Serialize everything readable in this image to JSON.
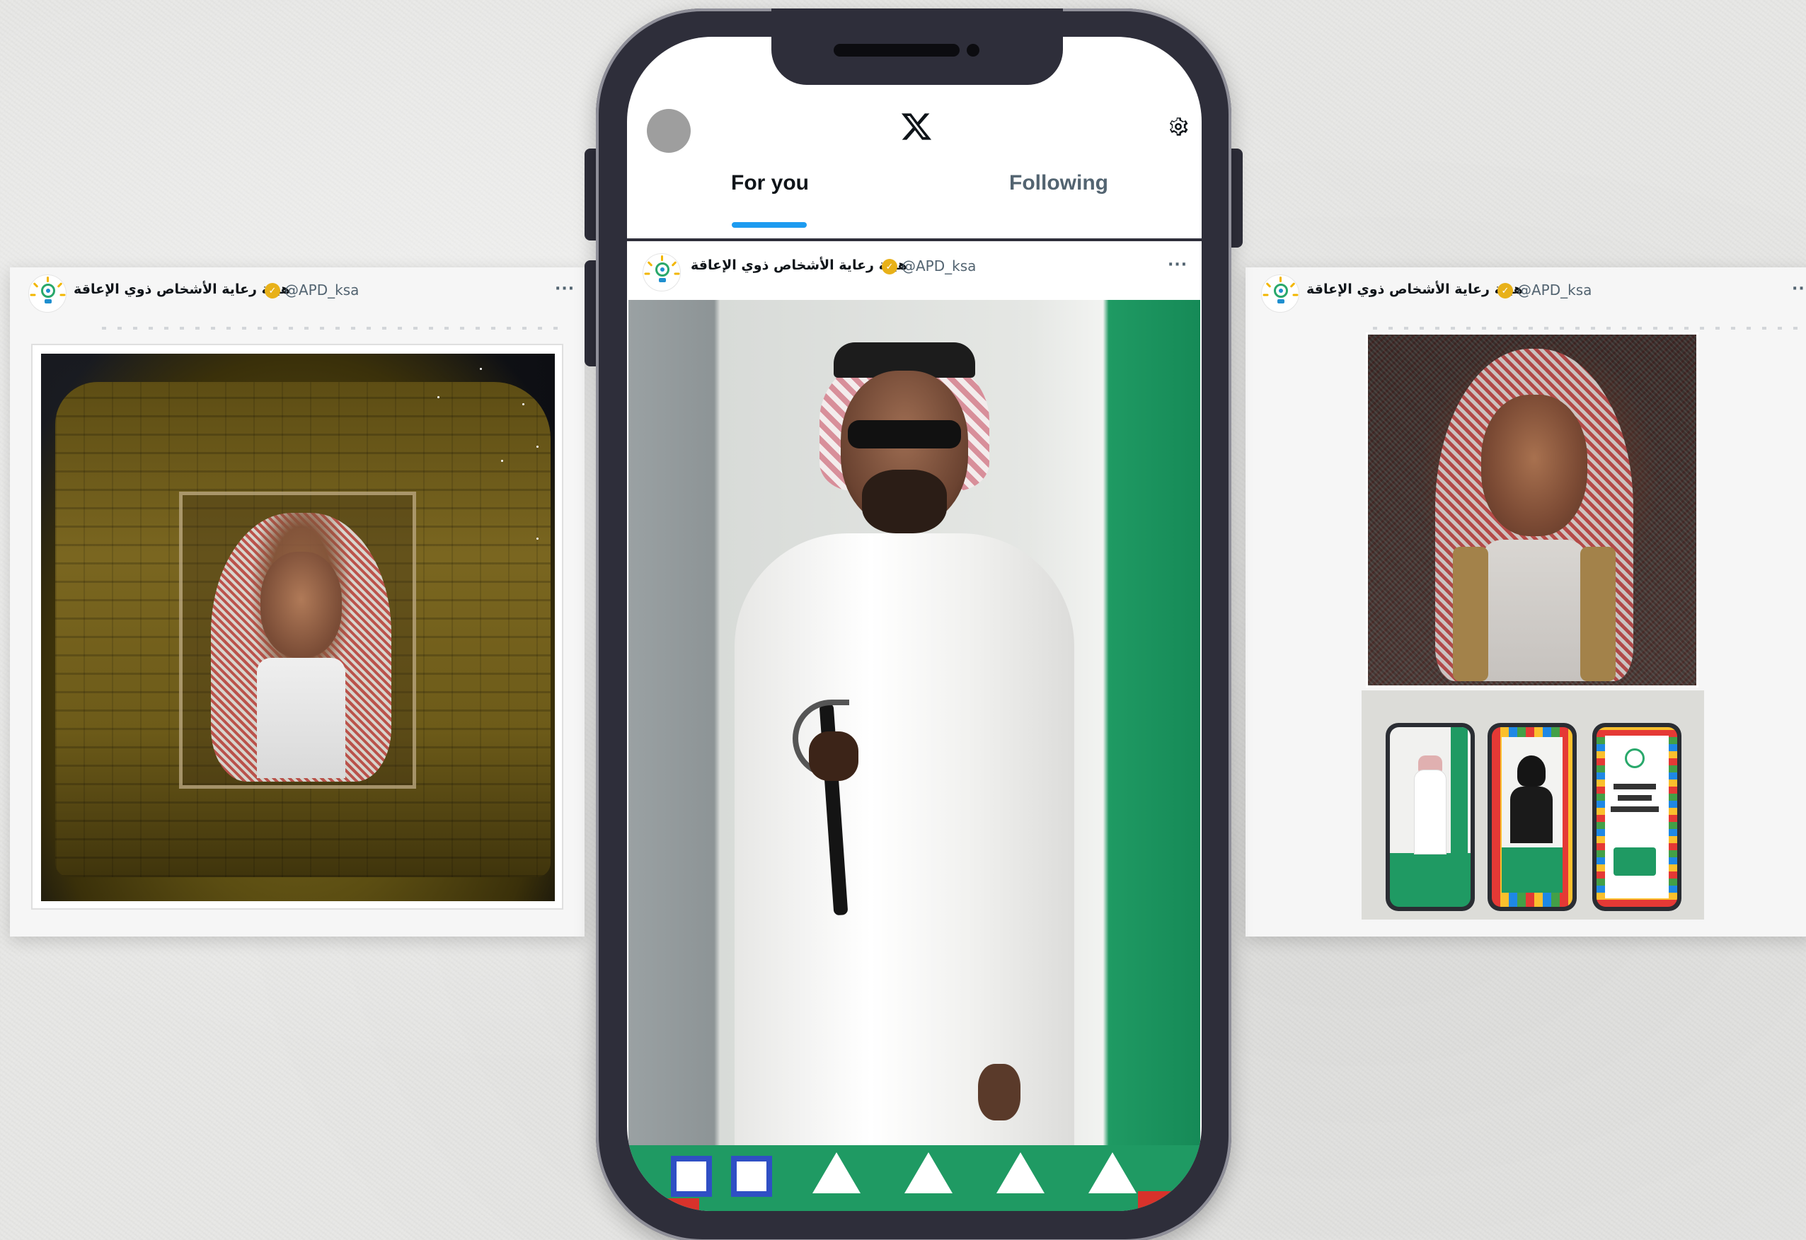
{
  "left_card": {
    "account_name": "هيئة رعاية الأشخاص ذوي الإعاقة",
    "handle": "@APD_ksa",
    "more": "···"
  },
  "right_card": {
    "account_name": "هيئة رعاية الأشخاص ذوي الإعاقة",
    "handle": "@APD_ksa",
    "more": "···"
  },
  "phone_app": {
    "logo": "x-logo",
    "tabs": [
      {
        "label": "For you",
        "active": true
      },
      {
        "label": "Following",
        "active": false
      }
    ],
    "post": {
      "account_name": "هيئة رعاية الأشخاص ذوي الإعاقة",
      "handle": "@APD_ksa",
      "more": "···"
    }
  },
  "colors": {
    "accent": "#1d9bf0",
    "verified": "#e8b119",
    "brand_green": "#1f9a63",
    "phone_body": "#2e2e3a"
  },
  "icons": [
    "profile-avatar",
    "x-logo",
    "gear-icon",
    "verified-badge-icon",
    "more-icon",
    "apd-logo-icon"
  ]
}
